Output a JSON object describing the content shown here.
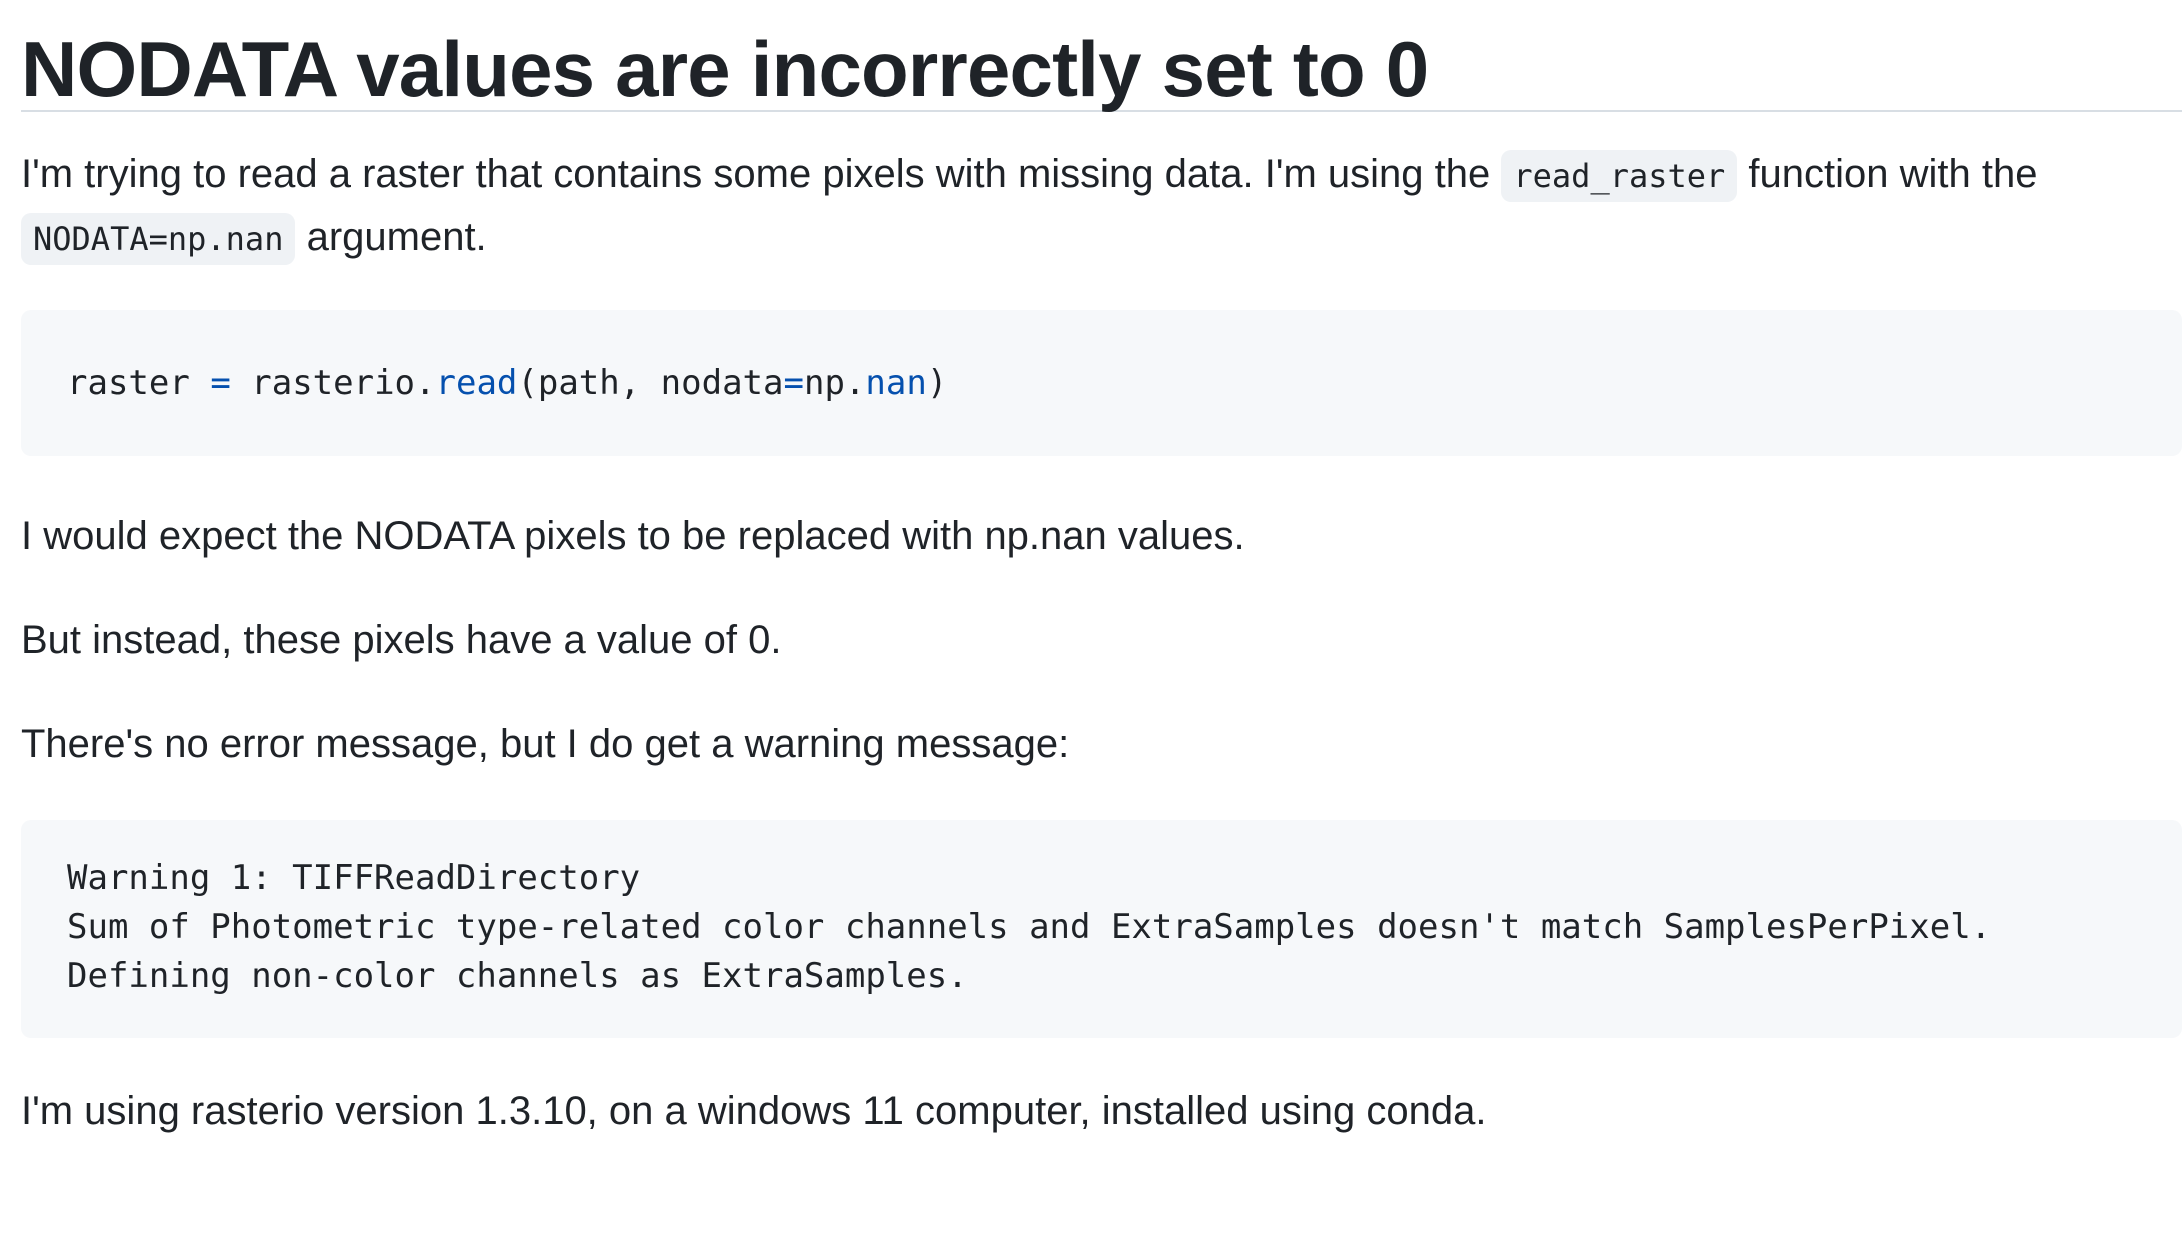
{
  "title": "NODATA values are incorrectly set to 0",
  "intro": {
    "text1": "I'm trying to read a raster that contains some pixels with missing data. I'm using the ",
    "code1": "read_raster",
    "text2": " function with the ",
    "code2": "NODATA=np.nan",
    "text3": " argument."
  },
  "code_block_1": {
    "tokens": [
      "raster",
      " ",
      "=",
      " rasterio.",
      "read",
      "(path, nodata",
      "=",
      "np.",
      "nan",
      ")"
    ]
  },
  "expect_text": "I would expect the NODATA pixels to be replaced with np.nan values.",
  "instead_text": "But instead, these pixels have a value of 0.",
  "error_text": "There's no error message, but I do get a warning message:",
  "code_block_2": {
    "lines": [
      "Warning 1: TIFFReadDirectory",
      "Sum of Photometric type-related color channels and ExtraSamples doesn't match SamplesPerPixel.",
      "Defining non-color channels as ExtraSamples."
    ]
  },
  "version_text": "I'm using rasterio version 1.3.10, on a windows 11 computer, installed using conda.",
  "colors": {
    "text": "#1f2328",
    "code_bg": "#f6f8fa",
    "inline_code_bg": "#eff2f5",
    "syntax_blue": "#0550ae",
    "divider": "#d8dee4"
  }
}
